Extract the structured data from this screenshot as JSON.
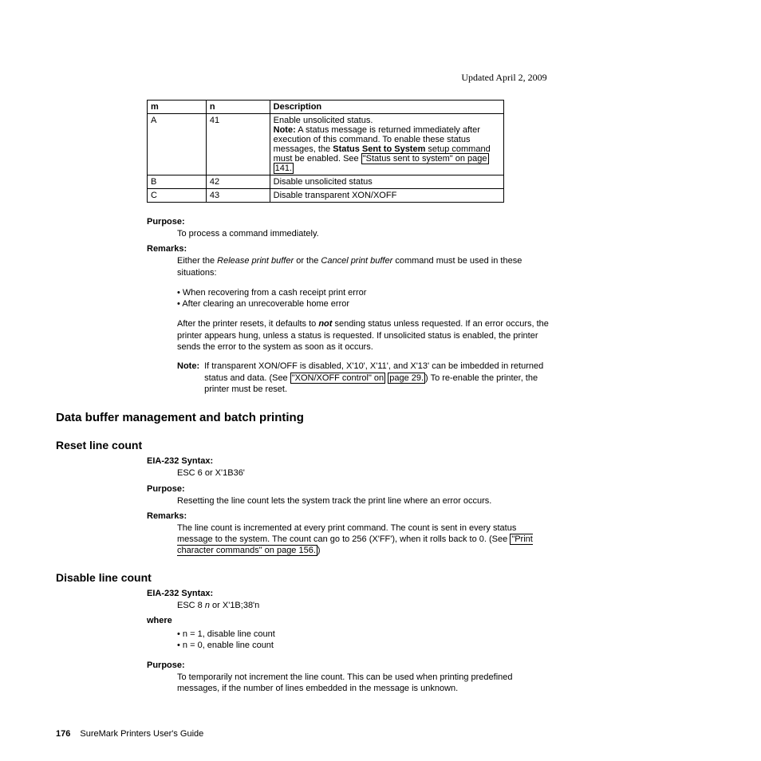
{
  "header": {
    "date": "Updated April 2, 2009"
  },
  "table": {
    "head": {
      "m": "m",
      "n": "n",
      "desc": "Description"
    },
    "rowA": {
      "m": "A",
      "n": "41",
      "line1": "Enable unsolicited status.",
      "noteLabel": "Note:",
      "line2a": "A status message is returned immediately after execution of this command. To enable these status messages, the ",
      "line2bold": "Status Sent to System",
      "line2b": " setup command must be enabled. See ",
      "link1_a": "\"Status sent to system\" on page",
      "link1_b": "141."
    },
    "rowB": {
      "m": "B",
      "n": "42",
      "desc": "Disable unsolicited status"
    },
    "rowC": {
      "m": "C",
      "n": "43",
      "desc": "Disable transparent XON/XOFF"
    }
  },
  "purpose1": {
    "label": "Purpose:",
    "text": "To process a command immediately."
  },
  "remarks1": {
    "label": "Remarks:",
    "intro_a": "Either the ",
    "intro_i1": "Release print buffer",
    "intro_b": " or the ",
    "intro_i2": "Cancel print buffer",
    "intro_c": " command must be used in these situations:",
    "b1": "When recovering from a cash receipt print error",
    "b2": "After clearing an unrecoverable home error",
    "para_a": "After the printer resets, it defaults to ",
    "para_bold": "not",
    "para_b": " sending status unless requested. If an error occurs, the printer appears hung, unless a status is requested. If unsolicited status is enabled, the printer sends the error to the system as soon as it occurs.",
    "noteLabel": "Note:",
    "note_a": "If transparent XON/OFF is disabled, X'10', X'11', and X'13' can be imbedded in returned status and data. (See ",
    "note_link_a": "\"XON/XOFF control\" on",
    "note_link_b": "page 29.",
    "note_b": ") To re-enable the printer, the printer must be reset."
  },
  "head1": "Data buffer management and batch printing",
  "head2": "Reset line count",
  "reset": {
    "syntaxLabel": "EIA-232 Syntax:",
    "syntax": "ESC 6 or X'1B36'",
    "purposeLabel": "Purpose:",
    "purpose": "Resetting the line count lets the system track the print line where an error occurs.",
    "remarksLabel": "Remarks:",
    "remarks_a": "The line count is incremented at every print command. The count is sent in every status message to the system. The count can go to 256 (X'FF'), when it rolls back to 0. (See ",
    "remarks_link": "\"Print character commands\" on page 156.",
    "remarks_b": ")"
  },
  "head3": "Disable line count",
  "disable": {
    "syntaxLabel": "EIA-232 Syntax:",
    "syntax_a": "ESC 8 ",
    "syntax_i": "n",
    "syntax_b": " or X'1B;38'n",
    "whereLabel": "where",
    "b1": "n = 1, disable line count",
    "b2": "n = 0, enable line count",
    "purposeLabel": "Purpose:",
    "purpose": "To temporarily not increment the line count. This can be used when printing predefined messages, if the number of lines embedded in the message is unknown."
  },
  "footer": {
    "page": "176",
    "title": "SureMark Printers User's Guide"
  }
}
